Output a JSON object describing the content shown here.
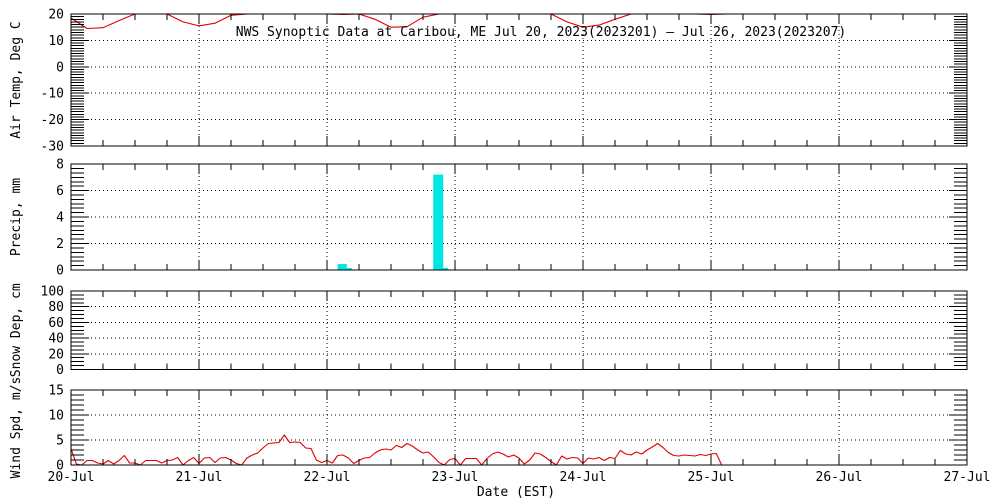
{
  "background": "#ffffff",
  "chart_data": {
    "type": "line",
    "title": "NWS Synoptic Data at Caribou, ME   Jul 20, 2023(2023201) — Jul 26, 2023(2023207)",
    "xlabel": "Date (EST)",
    "x_tick_labels": [
      "20-Jul",
      "21-Jul",
      "22-Jul",
      "23-Jul",
      "24-Jul",
      "25-Jul",
      "26-Jul",
      "27-Jul"
    ],
    "x_range_days": 7,
    "x_minor_ticks_per_day": 4,
    "grid": "dotted",
    "axis_color": "#000000",
    "panels": [
      {
        "name": "air-temp",
        "ylabel": "Air Temp, Deg C",
        "ylim": [
          -30,
          20
        ],
        "yticks": [
          20,
          10,
          0,
          -10,
          -20,
          -30
        ],
        "minor_step": 1,
        "line_color": "#e00000",
        "display_clip_max": 20,
        "series": {
          "start": "Jul 20 00:00 EST",
          "step_hours": 3,
          "units": "deg C",
          "values": [
            18.5,
            14.5,
            14.8,
            17.5,
            20.5,
            21.5,
            21.0,
            17.0,
            15.5,
            16.5,
            19.5,
            21.0,
            22.0,
            22.5,
            21.5,
            20.5,
            20.5,
            19.8,
            20.5,
            18.0,
            15.0,
            15.2,
            18.8,
            20.5,
            21.0,
            21.5,
            22.0,
            22.5,
            22.0,
            21.5,
            20.5,
            17.0,
            15.0,
            15.8,
            18.0,
            21.0,
            22.0,
            22.5,
            22.0,
            21.0,
            19.8,
            20.5
          ]
        }
      },
      {
        "name": "precip",
        "ylabel": "Precip, mm",
        "ylim": [
          0,
          8
        ],
        "yticks": [
          8,
          6,
          4,
          2,
          0
        ],
        "minor_step": 0.333,
        "bar_color": "#00e5e5",
        "bars": [
          {
            "day_offset": 2.083,
            "width_days": 0.072,
            "value": 0.45
          },
          {
            "day_offset": 2.156,
            "width_days": 0.038,
            "value": 0.15
          },
          {
            "day_offset": 2.83,
            "width_days": 0.078,
            "value": 7.2
          },
          {
            "day_offset": 2.908,
            "width_days": 0.039,
            "value": 0.15
          }
        ]
      },
      {
        "name": "snow-depth",
        "ylabel": "Snow Dep, cm",
        "ylim": [
          0,
          100
        ],
        "yticks": [
          100,
          80,
          60,
          40,
          20,
          0
        ],
        "minor_step": 5
      },
      {
        "name": "wind-speed",
        "ylabel": "Wind Spd, m/s",
        "ylim": [
          0,
          15
        ],
        "yticks": [
          15,
          10,
          5,
          0
        ],
        "minor_step": 1,
        "line_color": "#e00000",
        "series": {
          "start": "Jul 20 00:00 EST",
          "step_hours": 1,
          "units": "m/s",
          "values": [
            3.3,
            0.2,
            0,
            0.9,
            0.9,
            0.4,
            0.2,
            0.9,
            0.2,
            0.9,
            1.9,
            0.4,
            0.4,
            0,
            0.9,
            0.9,
            0.9,
            0.4,
            0.9,
            1.0,
            1.5,
            0,
            0.9,
            1.5,
            0.3,
            1.4,
            1.5,
            0.5,
            1.4,
            1.5,
            1.0,
            0.3,
            0,
            1.4,
            2.0,
            2.4,
            3.4,
            4.3,
            4.4,
            4.5,
            6.0,
            4.5,
            4.6,
            4.5,
            3.4,
            3.3,
            1.0,
            0.5,
            0.9,
            0.4,
            1.9,
            2.0,
            1.4,
            0.3,
            0.9,
            1.4,
            1.5,
            2.4,
            3.0,
            3.2,
            3.0,
            3.9,
            3.5,
            4.3,
            3.8,
            3.0,
            2.4,
            2.6,
            1.6,
            0.5,
            0,
            1.1,
            1.3,
            0,
            1.3,
            1.3,
            1.3,
            0,
            1.3,
            2.2,
            2.6,
            2.2,
            1.6,
            2.0,
            1.4,
            0.2,
            1.0,
            2.4,
            2.2,
            1.5,
            0.7,
            0,
            1.8,
            1.2,
            1.5,
            1.4,
            0.3,
            1.4,
            1.2,
            1.5,
            0.9,
            1.5,
            1.3,
            2.9,
            2.2,
            2.0,
            2.6,
            2.2,
            3.0,
            3.6,
            4.3,
            3.5,
            2.5,
            1.9,
            1.8,
            2.0,
            1.9,
            1.8,
            2.1,
            1.9,
            2.2,
            2.3,
            0
          ]
        }
      }
    ]
  }
}
